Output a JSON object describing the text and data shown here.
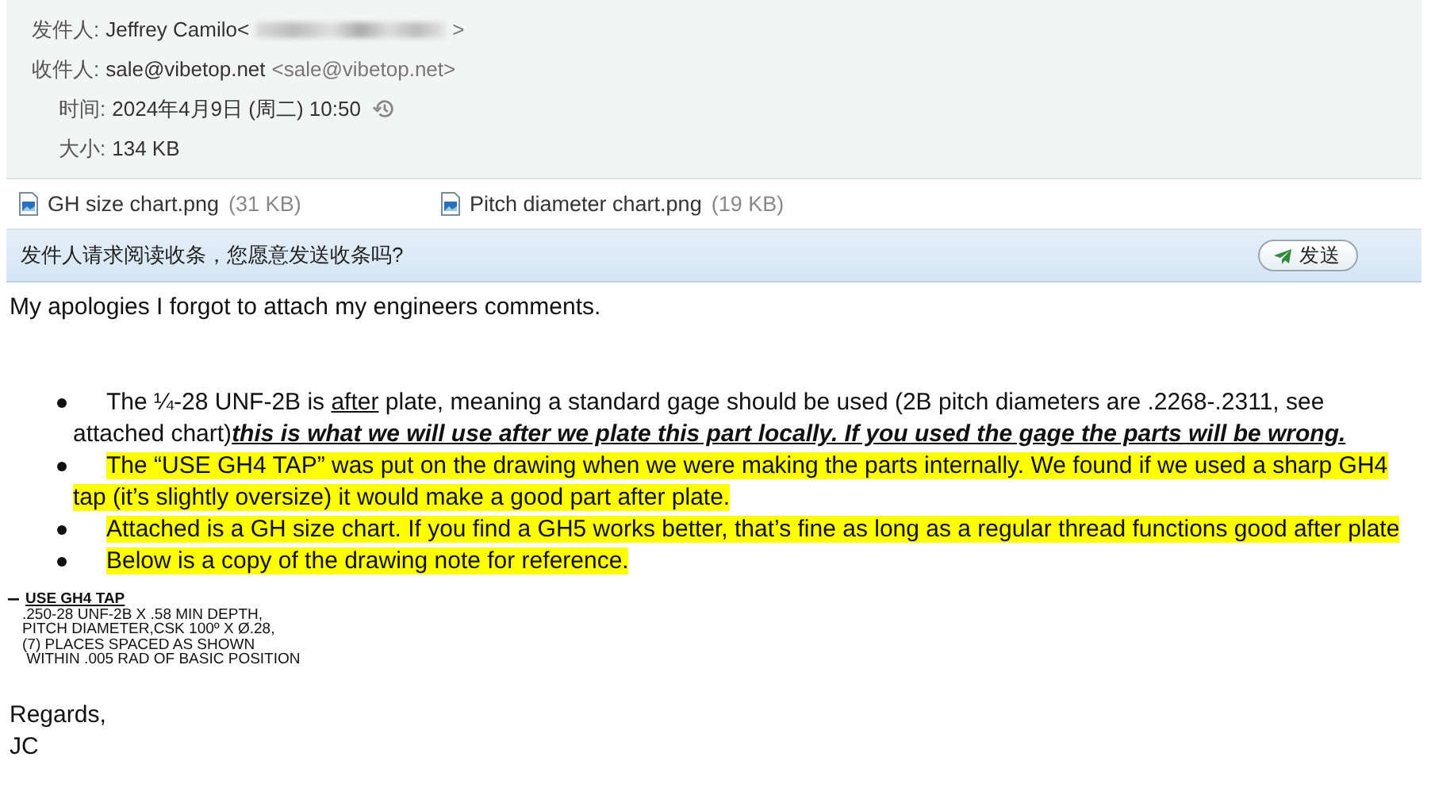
{
  "header": {
    "fields": [
      {
        "label": "发件人:",
        "value": "Jeffrey Camilo<",
        "kind": "redacted",
        "suffix": ">"
      },
      {
        "label": "收件人:",
        "value": "sale@vibetop.net",
        "kind": "address",
        "suffix": "<sale@vibetop.net>"
      },
      {
        "label": "时间:",
        "value": "2024年4月9日 (周二) 10:50",
        "kind": "time"
      },
      {
        "label": "大小:",
        "value": "134 KB",
        "kind": "plain"
      }
    ]
  },
  "attachments": [
    {
      "name": "GH size chart.png",
      "size": "(31 KB)"
    },
    {
      "name": "Pitch diameter chart.png",
      "size": "(19 KB)"
    }
  ],
  "receipt_bar": {
    "message": "发件人请求阅读收条，您愿意发送收条吗?",
    "button": "发送"
  },
  "body": {
    "intro": "My apologies I forgot to attach my engineers comments.",
    "bullets": [
      {
        "highlighted": false,
        "segments": [
          {
            "kind": "plain",
            "text": "The ¼-28 UNF-2B is "
          },
          {
            "kind": "underline",
            "text": "after"
          },
          {
            "kind": "plain",
            "text": " plate, meaning a standard gage should be used (2B pitch diameters are .2268-.2311, see attached chart)"
          },
          {
            "kind": "emphasis",
            "text": "this is what we will use after we plate this part locally.  If you used the gage the parts will be wrong."
          }
        ]
      },
      {
        "highlighted": true,
        "segments": [
          {
            "kind": "plain",
            "text": "The  “USE GH4 TAP”  was put on the drawing when we were making the parts internally. We found if we used a sharp GH4 tap (it’s slightly oversize) it would make a good part after plate."
          }
        ]
      },
      {
        "highlighted": true,
        "segments": [
          {
            "kind": "plain",
            "text": "Attached is a GH size chart. If you find a GH5 works better, that’s fine as long as a regular thread functions good after plate"
          }
        ]
      },
      {
        "highlighted": true,
        "segments": [
          {
            "kind": "plain",
            "text": "Below is a copy of the drawing note for reference."
          }
        ]
      }
    ],
    "drawing_note": {
      "title": "USE GH4 TAP",
      "lines": [
        ".250-28 UNF-2B X .58 MIN DEPTH,",
        "PITCH DIAMETER,CSK 100º X Ø.28,",
        "(7) PLACES SPACED AS SHOWN",
        " WITHIN .005 RAD OF BASIC POSITION"
      ]
    },
    "closing": [
      "Regards,",
      "JC"
    ]
  }
}
